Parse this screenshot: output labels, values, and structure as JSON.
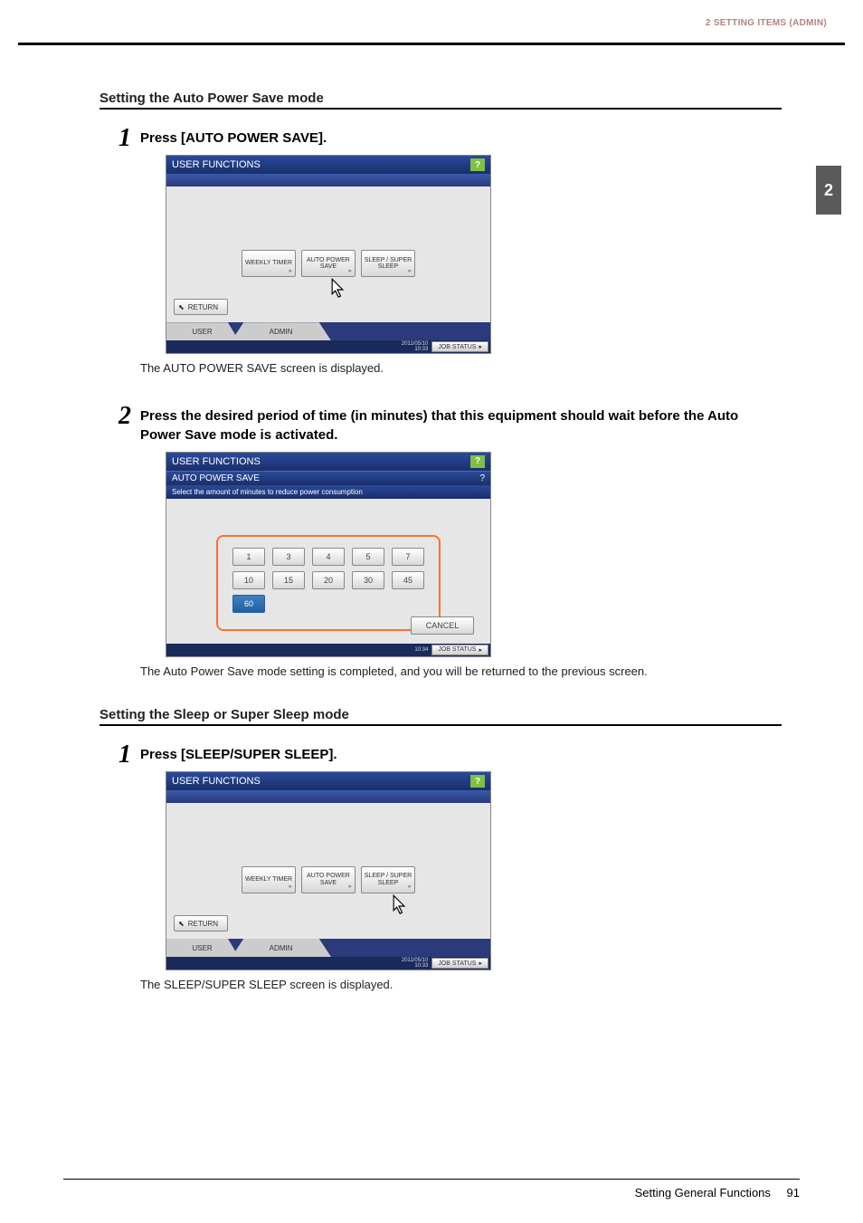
{
  "header": {
    "running": "2 SETTING ITEMS (ADMIN)"
  },
  "side_tab": "2",
  "section1": {
    "title": "Setting the Auto Power Save mode",
    "step1": {
      "num": "1",
      "title": "Press [AUTO POWER SAVE].",
      "note": "The AUTO POWER SAVE screen is displayed.",
      "panel": {
        "title": "USER FUNCTIONS",
        "help": "?",
        "buttons": {
          "b1": "WEEKLY TIMER",
          "b2": "AUTO POWER SAVE",
          "b3": "SLEEP / SUPER SLEEP"
        },
        "return": "RETURN",
        "tabs": {
          "user": "USER",
          "admin": "ADMIN"
        },
        "status": {
          "date": "2011/05/10\n10:33",
          "job": "JOB STATUS"
        }
      }
    },
    "step2": {
      "num": "2",
      "title": "Press the desired period of time (in minutes) that this equipment should wait before the Auto Power Save mode is activated.",
      "note": "The Auto Power Save mode setting is completed, and you will be returned to the previous screen.",
      "panel": {
        "title": "USER FUNCTIONS",
        "sub": "AUTO POWER SAVE",
        "help": "?",
        "instr": "Select the amount of minutes to reduce power consumption",
        "row1": [
          "1",
          "3",
          "4",
          "5",
          "7"
        ],
        "row2": [
          "10",
          "15",
          "20",
          "30",
          "45"
        ],
        "row3": [
          "60"
        ],
        "cancel": "CANCEL",
        "status": {
          "date": "10:34",
          "job": "JOB STATUS"
        }
      }
    }
  },
  "section2": {
    "title": "Setting the Sleep or Super Sleep mode",
    "step1": {
      "num": "1",
      "title": "Press [SLEEP/SUPER SLEEP].",
      "note": "The SLEEP/SUPER SLEEP screen is displayed.",
      "panel": {
        "title": "USER FUNCTIONS",
        "help": "?",
        "buttons": {
          "b1": "WEEKLY TIMER",
          "b2": "AUTO POWER SAVE",
          "b3": "SLEEP / SUPER SLEEP"
        },
        "return": "RETURN",
        "tabs": {
          "user": "USER",
          "admin": "ADMIN"
        },
        "status": {
          "date": "2011/05/10\n10:33",
          "job": "JOB STATUS"
        }
      }
    }
  },
  "footer": {
    "section": "Setting General Functions",
    "page": "91"
  }
}
